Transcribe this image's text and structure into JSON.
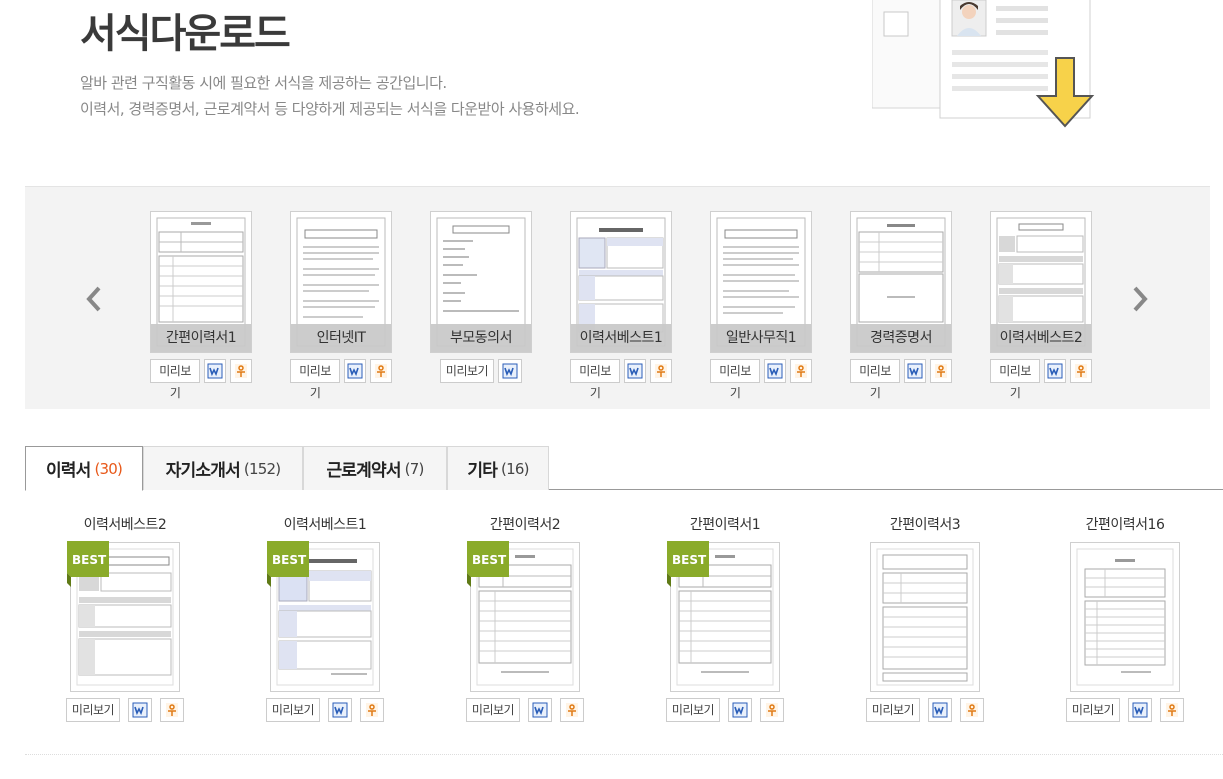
{
  "header": {
    "title": "서식다운로드",
    "desc_line1": "알바 관련 구직활동 시에 필요한 서식을 제공하는 공간입니다.",
    "desc_line2": "이력서, 경력증명서, 근로계약서 등 다양하게 제공되는 서식을 다운받아 사용하세요."
  },
  "actions": {
    "preview_label": "미리보기"
  },
  "carousel": [
    {
      "label": "간편이력서1",
      "hwp": true
    },
    {
      "label": "인터넷IT",
      "hwp": true
    },
    {
      "label": "부모동의서",
      "hwp": false
    },
    {
      "label": "이력서베스트1",
      "hwp": true
    },
    {
      "label": "일반사무직1",
      "hwp": true
    },
    {
      "label": "경력증명서",
      "hwp": true
    },
    {
      "label": "이력서베스트2",
      "hwp": true
    }
  ],
  "tabs": [
    {
      "label": "이력서",
      "count": "(30)"
    },
    {
      "label": "자기소개서",
      "count": "(152)"
    },
    {
      "label": "근로계약서",
      "count": "(7)"
    },
    {
      "label": "기타",
      "count": "(16)"
    }
  ],
  "grid": [
    {
      "title": "이력서베스트2",
      "best": true
    },
    {
      "title": "이력서베스트1",
      "best": true
    },
    {
      "title": "간편이력서2",
      "best": true
    },
    {
      "title": "간편이력서1",
      "best": true
    },
    {
      "title": "간편이력서3",
      "best": false
    },
    {
      "title": "간편이력서16",
      "best": false
    }
  ],
  "badge": {
    "best_label": "BEST"
  },
  "colors": {
    "accent": "#e8591a",
    "badge_green": "#8aab2a",
    "arrow_yellow": "#f7d24a"
  }
}
